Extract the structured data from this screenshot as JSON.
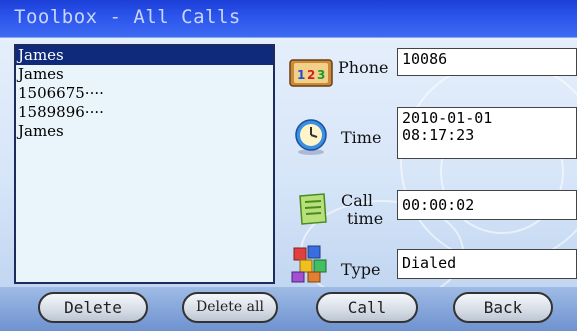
{
  "window": {
    "title": "Toolbox - All Calls"
  },
  "call_list": {
    "items": [
      {
        "label": "James",
        "selected": true
      },
      {
        "label": "James",
        "selected": false
      },
      {
        "label": "1506675····",
        "selected": false
      },
      {
        "label": "1589896····",
        "selected": false
      },
      {
        "label": "James",
        "selected": false
      }
    ]
  },
  "details": {
    "phone": {
      "label": "Phone",
      "value": "10086",
      "icon": "phone-book-icon"
    },
    "time": {
      "label": "Time",
      "value_line1": "2010-01-01",
      "value_line2": "08:17:23",
      "icon": "clock-icon"
    },
    "call_time": {
      "label_line1": "Call",
      "label_line2": "time",
      "value": "00:00:02",
      "icon": "notepad-icon"
    },
    "type": {
      "label": "Type",
      "value": "Dialed",
      "icon": "blocks-icon"
    }
  },
  "buttons": {
    "delete": "Delete",
    "delete_all": "Delete all",
    "call": "Call",
    "back": "Back"
  },
  "colors": {
    "title_bar": "#2c55ec",
    "selected_row": "#0f2a7a",
    "background": "#d6e5f8"
  }
}
